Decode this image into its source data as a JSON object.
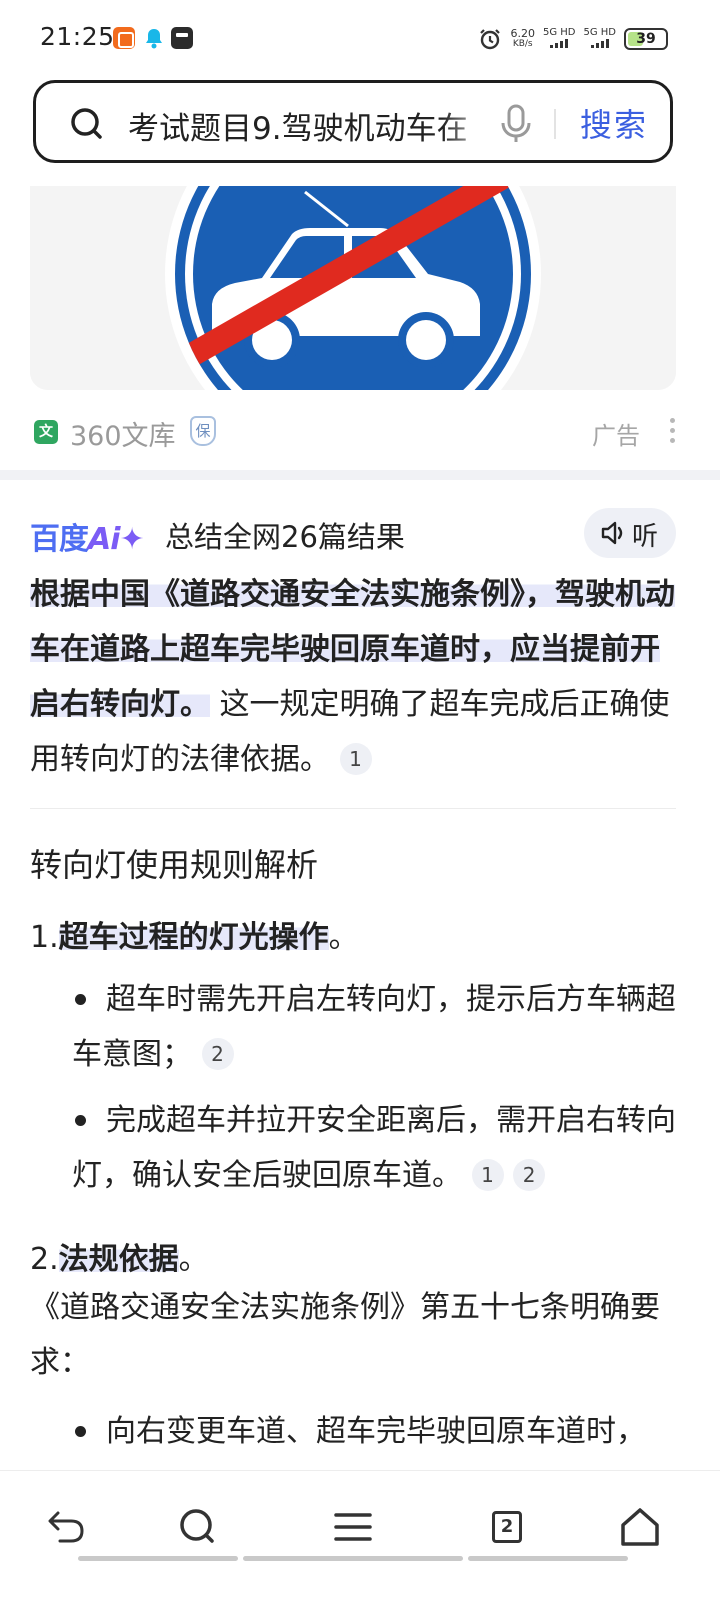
{
  "status_bar": {
    "time": "21:25",
    "net_speed": "6.20",
    "net_speed_unit": "KB/s",
    "sim1": "5G HD",
    "sim2": "5G HD",
    "battery": "39"
  },
  "search": {
    "query": "考试题目9.驾驶机动车在",
    "button_label": "搜索"
  },
  "image_card": {
    "source_name": "360文库",
    "source_logo": "文",
    "source_badge": "保",
    "ad_label": "广告"
  },
  "ai_summary": {
    "logo_text": "百度",
    "logo_ai": "Ai✦",
    "summary_label": "总结全网26篇结果",
    "listen_label": "听",
    "answer_highlight": "根据中国《道路交通安全法实施条例》，驾驶机动车在道路上超车完毕驶回原车道时，应当提前开启右转向灯。",
    "answer_rest": " 这一规定明确了超车完成后正确使用转向灯的法律依据。",
    "answer_cite": "1"
  },
  "analysis": {
    "title": "转向灯使用规则解析",
    "item1_num": "1.",
    "item1_title": "超车过程的灯光操作",
    "item1_end": "。",
    "bullet1": "超车时需先开启左转向灯，提示后方车辆超车意图；",
    "bullet1_cite": "2",
    "bullet2": "完成超车并拉开安全距离后，需开启右转向灯，确认安全后驶回原车道。",
    "bullet2_cite_a": "1",
    "bullet2_cite_b": "2",
    "item2_num": "2.",
    "item2_title": "法规依据",
    "item2_end": "。",
    "para": "《道路交通安全法实施条例》第五十七条明确要求：",
    "bullet3": "向右变更车道、超车完毕驶回原车道时，"
  },
  "bottom_nav": {
    "tab_count": "2",
    "icons": [
      "back-icon",
      "search-icon",
      "menu-icon",
      "tabs-icon",
      "home-icon"
    ]
  },
  "colors": {
    "accent": "#4e6ef2",
    "search_button": "#3b5fe0",
    "sign_blue": "#1a5fb4",
    "sign_red": "#e02a1f"
  }
}
